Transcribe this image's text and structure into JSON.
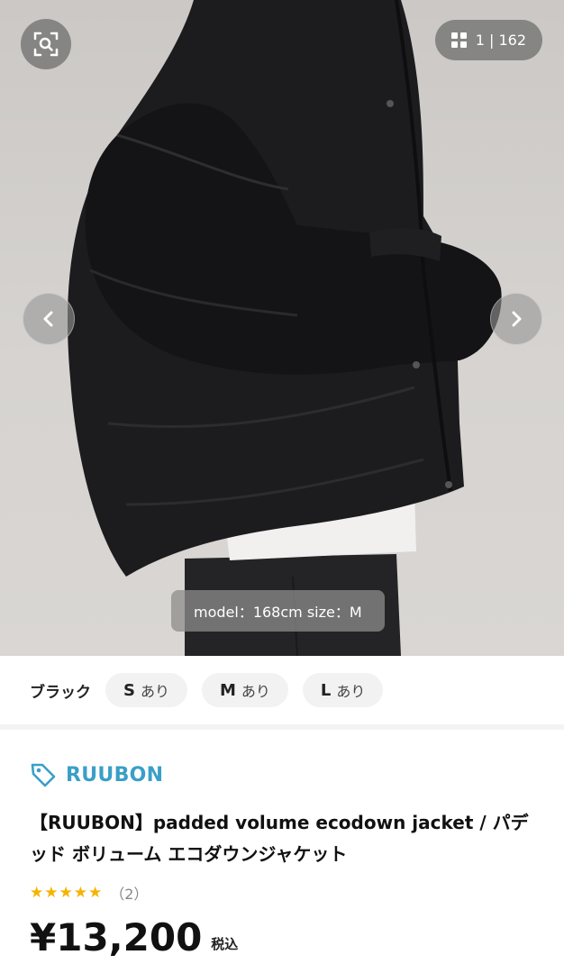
{
  "gallery": {
    "counter": "1 | 162",
    "caption": "model：168cm size：M"
  },
  "variants": {
    "color": "ブラック",
    "sizes": [
      {
        "size": "S",
        "stock": "あり"
      },
      {
        "size": "M",
        "stock": "あり"
      },
      {
        "size": "L",
        "stock": "あり"
      }
    ]
  },
  "product": {
    "brand": "RUUBON",
    "title": "【RUUBON】padded volume ecodown jacket / パデッド ボリューム エコダウンジャケット",
    "stars": "★★★★★",
    "rating_value": 5,
    "review_count": "（2）",
    "price": "¥13,200",
    "tax_label": "税込"
  },
  "colors": {
    "brand": "#3a9fc8",
    "star": "#f5b400"
  }
}
